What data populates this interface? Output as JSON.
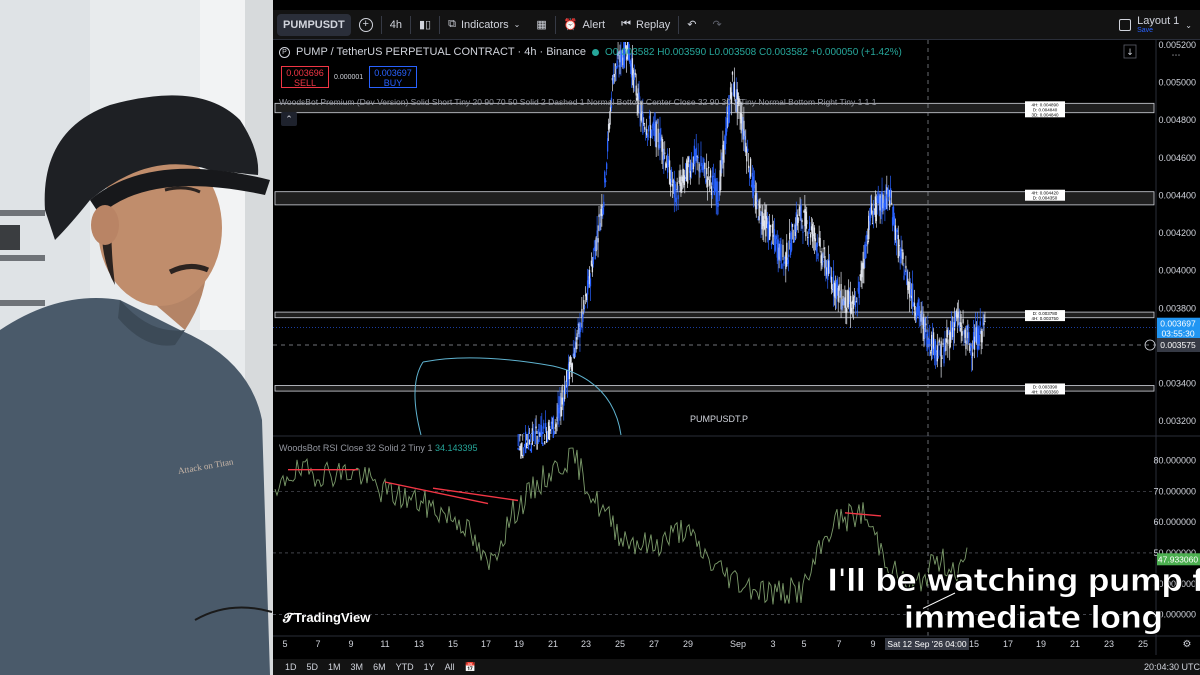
{
  "toolbar": {
    "symbol": "PUMPUSDT",
    "timeframe": "4h",
    "indicators_label": "Indicators",
    "alert_label": "Alert",
    "replay_label": "Replay",
    "layout_name": "Layout 1",
    "layout_save": "Save"
  },
  "legend": {
    "title": "PUMP / TetherUS PERPETUAL CONTRACT · 4h · Binance",
    "ohlc": "O0.003582 H0.003590 L0.003508 C0.003582 +0.000050 (+1.42%)"
  },
  "trade": {
    "sell_price": "0.003696",
    "sell_label": "SELL",
    "spread": "0.000001",
    "buy_price": "0.003697",
    "buy_label": "BUY"
  },
  "indicator_premium": "WoodsBot Premium (Dev Version) Solid Short Tiny 20 90 70 50 Solid 2 Dashed 1 Normal Bottom Center Close 32 90 30 2 Tiny Normal Bottom Right Tiny 1 1 1",
  "indicator_rsi": {
    "name": "WoodsBot RSI",
    "params": "Close 32 Solid 2 Tiny 1",
    "value": "34.143395"
  },
  "watermark_symbol": "PUMPUSDT.P",
  "tv_logo": "TradingView",
  "price_axis": [
    "0.005200",
    "0.005000",
    "0.004800",
    "0.004600",
    "0.004400",
    "0.004200",
    "0.004000",
    "0.003800",
    "0.003600",
    "0.003400",
    "0.003200"
  ],
  "current_price": {
    "value": "0.003697",
    "countdown": "03:55:30"
  },
  "crosshair_price": "0.003575",
  "rsi_axis": [
    "80.000000",
    "70.000000",
    "60.000000",
    "50.000000",
    "40.000000",
    "30.000000"
  ],
  "rsi_current": "47.933060",
  "zone_labels": [
    [
      "4H: 0.004890",
      "D: 0.004840",
      "3D: 0.004840"
    ],
    [
      "4H: 0.004420",
      "D: 0.004350"
    ],
    [
      "D: 0.003780",
      "4H: 0.003750"
    ],
    [
      "D: 0.003390",
      "4H: 0.003360"
    ]
  ],
  "time_axis": [
    "5",
    "7",
    "9",
    "11",
    "13",
    "15",
    "17",
    "19",
    "21",
    "23",
    "25",
    "27",
    "29",
    "Sep",
    "3",
    "5",
    "7",
    "9",
    "15",
    "17",
    "19",
    "21",
    "23",
    "25"
  ],
  "crosshair_time": "Sat 12 Sep '26   04:00",
  "timeframes": [
    "1D",
    "5D",
    "1M",
    "3M",
    "6M",
    "YTD",
    "1Y",
    "All"
  ],
  "clock": "20:04:30 UTC",
  "caption": [
    "I'll be watching pump for",
    "immediate long"
  ],
  "colors": {
    "up": "#2962ff",
    "down": "#ffffff",
    "rsi": "#7b9a6a",
    "divergence": "#f23645",
    "bg": "#000000"
  },
  "chart_data": {
    "type": "candlestick",
    "price_range": [
      0.0031,
      0.0052
    ],
    "rsi_range": [
      25,
      85
    ],
    "current_price": 0.003697
  }
}
